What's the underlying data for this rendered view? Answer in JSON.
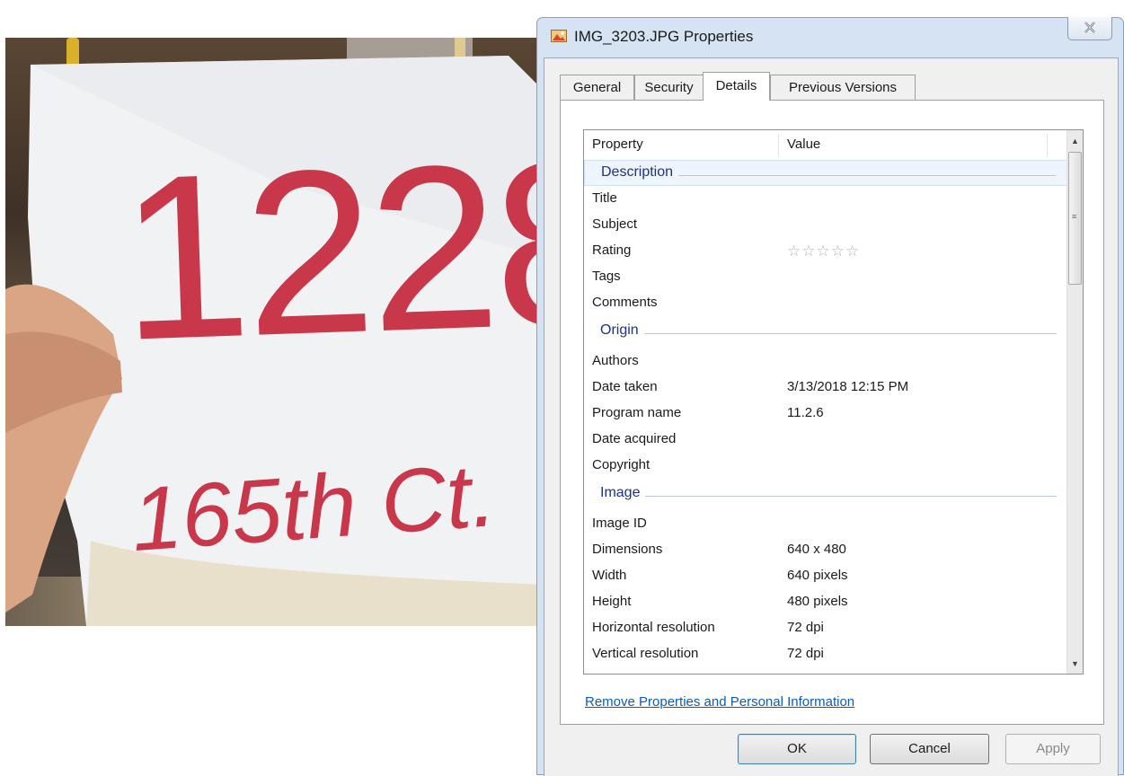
{
  "dialog": {
    "title": "IMG_3203.JPG Properties"
  },
  "tabs": [
    {
      "label": "General"
    },
    {
      "label": "Security"
    },
    {
      "label": "Details"
    },
    {
      "label": "Previous Versions"
    }
  ],
  "details": {
    "header": {
      "property": "Property",
      "value": "Value"
    },
    "groups": {
      "description": "Description",
      "origin": "Origin",
      "image": "Image"
    },
    "rows": {
      "title": {
        "p": "Title",
        "v": ""
      },
      "subject": {
        "p": "Subject",
        "v": ""
      },
      "rating": {
        "p": "Rating",
        "v": "☆☆☆☆☆",
        "stars_filled": 0,
        "stars_total": 5
      },
      "tags": {
        "p": "Tags",
        "v": ""
      },
      "comments": {
        "p": "Comments",
        "v": ""
      },
      "authors": {
        "p": "Authors",
        "v": ""
      },
      "date_taken": {
        "p": "Date taken",
        "v": "3/13/2018 12:15 PM"
      },
      "program_name": {
        "p": "Program name",
        "v": "11.2.6"
      },
      "date_acquired": {
        "p": "Date acquired",
        "v": ""
      },
      "copyright": {
        "p": "Copyright",
        "v": ""
      },
      "image_id": {
        "p": "Image ID",
        "v": ""
      },
      "dimensions": {
        "p": "Dimensions",
        "v": "640 x 480"
      },
      "width": {
        "p": "Width",
        "v": "640 pixels"
      },
      "height": {
        "p": "Height",
        "v": "480 pixels"
      },
      "horizontal_resolution": {
        "p": "Horizontal resolution",
        "v": "72 dpi"
      },
      "vertical_resolution": {
        "p": "Vertical resolution",
        "v": "72 dpi"
      }
    }
  },
  "remove_link": "Remove Properties and Personal Information",
  "buttons": {
    "ok": "OK",
    "cancel": "Cancel",
    "apply": "Apply"
  },
  "photo": {
    "handwriting": {
      "line1": "1228",
      "line2": "165th Ct."
    }
  },
  "icons": {
    "title": "image-file-icon",
    "close": "close-icon",
    "scroll_up": "scroll-up-arrow-icon",
    "scroll_down": "scroll-down-arrow-icon",
    "rating": "star-icon"
  },
  "colors": {
    "group_heading": "#1e3287",
    "link": "#0a5cb8",
    "handwriting": "#c8374a"
  }
}
